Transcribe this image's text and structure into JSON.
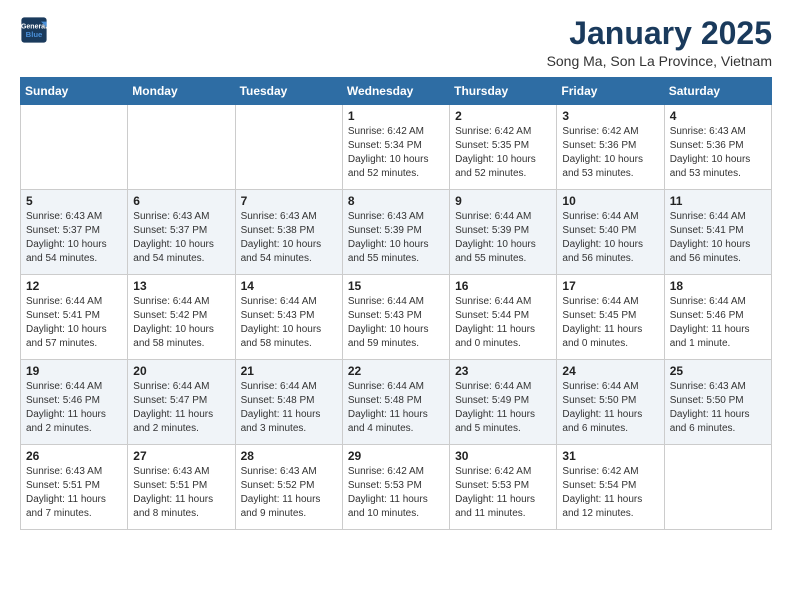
{
  "logo": {
    "line1": "General",
    "line2": "Blue"
  },
  "title": "January 2025",
  "subtitle": "Song Ma, Son La Province, Vietnam",
  "weekdays": [
    "Sunday",
    "Monday",
    "Tuesday",
    "Wednesday",
    "Thursday",
    "Friday",
    "Saturday"
  ],
  "rows": [
    {
      "cells": [
        {
          "day": "",
          "info": ""
        },
        {
          "day": "",
          "info": ""
        },
        {
          "day": "",
          "info": ""
        },
        {
          "day": "1",
          "info": "Sunrise: 6:42 AM\nSunset: 5:34 PM\nDaylight: 10 hours\nand 52 minutes."
        },
        {
          "day": "2",
          "info": "Sunrise: 6:42 AM\nSunset: 5:35 PM\nDaylight: 10 hours\nand 52 minutes."
        },
        {
          "day": "3",
          "info": "Sunrise: 6:42 AM\nSunset: 5:36 PM\nDaylight: 10 hours\nand 53 minutes."
        },
        {
          "day": "4",
          "info": "Sunrise: 6:43 AM\nSunset: 5:36 PM\nDaylight: 10 hours\nand 53 minutes."
        }
      ]
    },
    {
      "cells": [
        {
          "day": "5",
          "info": "Sunrise: 6:43 AM\nSunset: 5:37 PM\nDaylight: 10 hours\nand 54 minutes."
        },
        {
          "day": "6",
          "info": "Sunrise: 6:43 AM\nSunset: 5:37 PM\nDaylight: 10 hours\nand 54 minutes."
        },
        {
          "day": "7",
          "info": "Sunrise: 6:43 AM\nSunset: 5:38 PM\nDaylight: 10 hours\nand 54 minutes."
        },
        {
          "day": "8",
          "info": "Sunrise: 6:43 AM\nSunset: 5:39 PM\nDaylight: 10 hours\nand 55 minutes."
        },
        {
          "day": "9",
          "info": "Sunrise: 6:44 AM\nSunset: 5:39 PM\nDaylight: 10 hours\nand 55 minutes."
        },
        {
          "day": "10",
          "info": "Sunrise: 6:44 AM\nSunset: 5:40 PM\nDaylight: 10 hours\nand 56 minutes."
        },
        {
          "day": "11",
          "info": "Sunrise: 6:44 AM\nSunset: 5:41 PM\nDaylight: 10 hours\nand 56 minutes."
        }
      ]
    },
    {
      "cells": [
        {
          "day": "12",
          "info": "Sunrise: 6:44 AM\nSunset: 5:41 PM\nDaylight: 10 hours\nand 57 minutes."
        },
        {
          "day": "13",
          "info": "Sunrise: 6:44 AM\nSunset: 5:42 PM\nDaylight: 10 hours\nand 58 minutes."
        },
        {
          "day": "14",
          "info": "Sunrise: 6:44 AM\nSunset: 5:43 PM\nDaylight: 10 hours\nand 58 minutes."
        },
        {
          "day": "15",
          "info": "Sunrise: 6:44 AM\nSunset: 5:43 PM\nDaylight: 10 hours\nand 59 minutes."
        },
        {
          "day": "16",
          "info": "Sunrise: 6:44 AM\nSunset: 5:44 PM\nDaylight: 11 hours\nand 0 minutes."
        },
        {
          "day": "17",
          "info": "Sunrise: 6:44 AM\nSunset: 5:45 PM\nDaylight: 11 hours\nand 0 minutes."
        },
        {
          "day": "18",
          "info": "Sunrise: 6:44 AM\nSunset: 5:46 PM\nDaylight: 11 hours\nand 1 minute."
        }
      ]
    },
    {
      "cells": [
        {
          "day": "19",
          "info": "Sunrise: 6:44 AM\nSunset: 5:46 PM\nDaylight: 11 hours\nand 2 minutes."
        },
        {
          "day": "20",
          "info": "Sunrise: 6:44 AM\nSunset: 5:47 PM\nDaylight: 11 hours\nand 2 minutes."
        },
        {
          "day": "21",
          "info": "Sunrise: 6:44 AM\nSunset: 5:48 PM\nDaylight: 11 hours\nand 3 minutes."
        },
        {
          "day": "22",
          "info": "Sunrise: 6:44 AM\nSunset: 5:48 PM\nDaylight: 11 hours\nand 4 minutes."
        },
        {
          "day": "23",
          "info": "Sunrise: 6:44 AM\nSunset: 5:49 PM\nDaylight: 11 hours\nand 5 minutes."
        },
        {
          "day": "24",
          "info": "Sunrise: 6:44 AM\nSunset: 5:50 PM\nDaylight: 11 hours\nand 6 minutes."
        },
        {
          "day": "25",
          "info": "Sunrise: 6:43 AM\nSunset: 5:50 PM\nDaylight: 11 hours\nand 6 minutes."
        }
      ]
    },
    {
      "cells": [
        {
          "day": "26",
          "info": "Sunrise: 6:43 AM\nSunset: 5:51 PM\nDaylight: 11 hours\nand 7 minutes."
        },
        {
          "day": "27",
          "info": "Sunrise: 6:43 AM\nSunset: 5:51 PM\nDaylight: 11 hours\nand 8 minutes."
        },
        {
          "day": "28",
          "info": "Sunrise: 6:43 AM\nSunset: 5:52 PM\nDaylight: 11 hours\nand 9 minutes."
        },
        {
          "day": "29",
          "info": "Sunrise: 6:42 AM\nSunset: 5:53 PM\nDaylight: 11 hours\nand 10 minutes."
        },
        {
          "day": "30",
          "info": "Sunrise: 6:42 AM\nSunset: 5:53 PM\nDaylight: 11 hours\nand 11 minutes."
        },
        {
          "day": "31",
          "info": "Sunrise: 6:42 AM\nSunset: 5:54 PM\nDaylight: 11 hours\nand 12 minutes."
        },
        {
          "day": "",
          "info": ""
        }
      ]
    }
  ]
}
